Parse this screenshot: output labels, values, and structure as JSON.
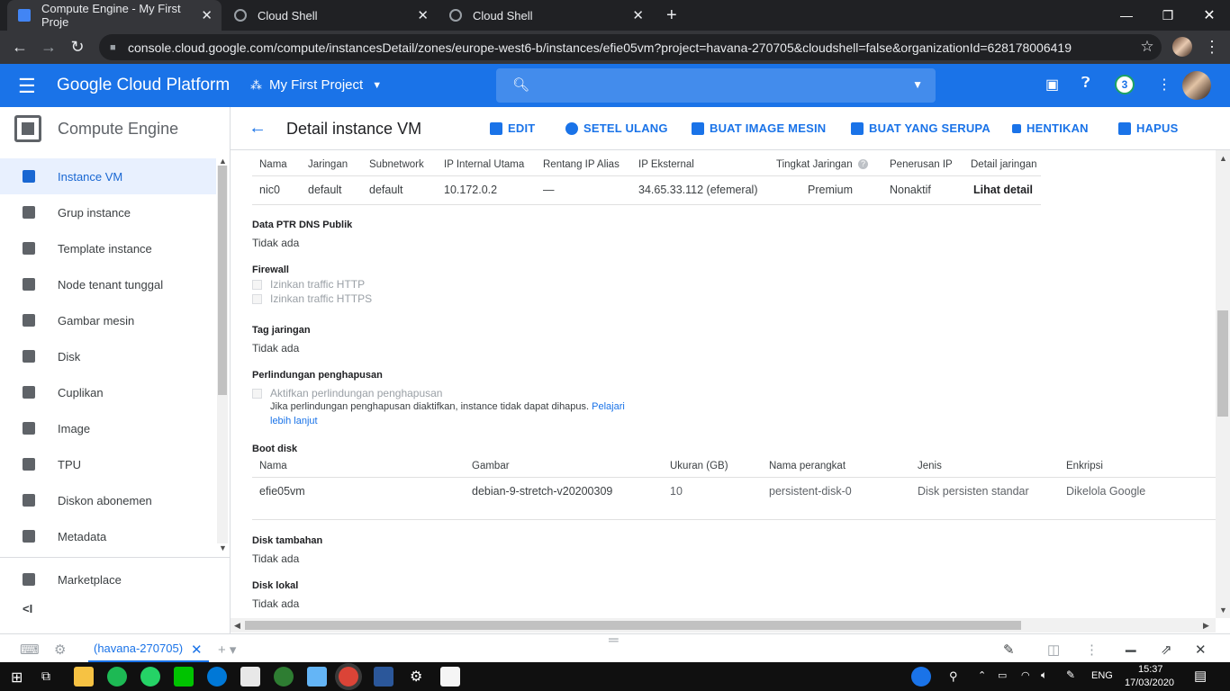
{
  "browser": {
    "tabs": [
      {
        "title": "Compute Engine - My First Proje",
        "active": true
      },
      {
        "title": "Cloud Shell",
        "active": false
      },
      {
        "title": "Cloud Shell",
        "active": false
      }
    ],
    "url": "console.cloud.google.com/compute/instancesDetail/zones/europe-west6-b/instances/efie05vm?project=havana-270705&cloudshell=false&organizationId=628178006419",
    "new_tab": "+"
  },
  "header": {
    "brand": "Google Cloud Platform",
    "project": "My First Project",
    "notification_count": "3"
  },
  "sidebar": {
    "title": "Compute Engine",
    "items": [
      {
        "label": "Instance VM",
        "active": true
      },
      {
        "label": "Grup instance"
      },
      {
        "label": "Template instance"
      },
      {
        "label": "Node tenant tunggal"
      },
      {
        "label": "Gambar mesin"
      },
      {
        "label": "Disk"
      },
      {
        "label": "Cuplikan"
      },
      {
        "label": "Image"
      },
      {
        "label": "TPU"
      },
      {
        "label": "Diskon abonemen"
      },
      {
        "label": "Metadata"
      }
    ],
    "marketplace": "Marketplace",
    "collapse": "<I"
  },
  "toolbar": {
    "title": "Detail instance VM",
    "edit": "EDIT",
    "reset": "SETEL ULANG",
    "create_image": "BUAT IMAGE MESIN",
    "create_similar": "BUAT YANG SERUPA",
    "stop": "HENTIKAN",
    "delete": "HAPUS"
  },
  "network_table": {
    "headers": [
      "Nama",
      "Jaringan",
      "Subnetwork",
      "IP Internal Utama",
      "Rentang IP Alias",
      "IP Eksternal",
      "Tingkat Jaringan",
      "Penerusan IP",
      "Detail jaringan"
    ],
    "row": [
      "nic0",
      "default",
      "default",
      "10.172.0.2",
      "—",
      "34.65.33.112 (efemeral)",
      "Premium",
      "Nonaktif",
      "Lihat detail"
    ]
  },
  "sections": {
    "dns_label": "Data PTR DNS Publik",
    "dns_value": "Tidak ada",
    "firewall_label": "Firewall",
    "firewall_http": "Izinkan traffic HTTP",
    "firewall_https": "Izinkan traffic HTTPS",
    "tags_label": "Tag jaringan",
    "tags_value": "Tidak ada",
    "protection_label": "Perlindungan penghapusan",
    "protection_checkbox": "Aktifkan perlindungan penghapusan",
    "protection_note": "Jika perlindungan penghapusan diaktifkan, instance tidak dapat dihapus.",
    "protection_link_1": "Pelajari",
    "protection_link_2": "lebih lanjut",
    "boot_label": "Boot disk",
    "extra_disk_label": "Disk tambahan",
    "extra_disk_value": "Tidak ada",
    "local_disk_label": "Disk lokal",
    "local_disk_value": "Tidak ada"
  },
  "boot_table": {
    "headers": [
      "Nama",
      "Gambar",
      "Ukuran (GB)",
      "Nama perangkat",
      "Jenis",
      "Enkripsi"
    ],
    "row": [
      "efie05vm",
      "debian-9-stretch-v20200309",
      "10",
      "persistent-disk-0",
      "Disk persisten standar",
      "Dikelola Google"
    ]
  },
  "shell": {
    "tab": "(havana-270705)"
  },
  "taskbar": {
    "lang": "ENG",
    "time": "15:37",
    "date": "17/03/2020"
  }
}
